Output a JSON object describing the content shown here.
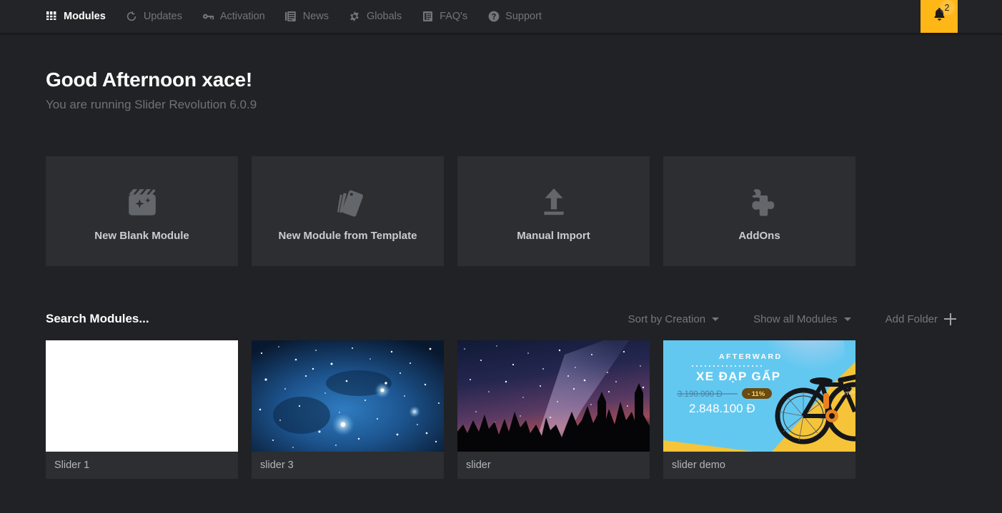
{
  "topbar": {
    "nav": [
      {
        "label": "Modules",
        "icon": "grid-icon",
        "active": true
      },
      {
        "label": "Updates",
        "icon": "refresh-icon",
        "active": false
      },
      {
        "label": "Activation",
        "icon": "key-icon",
        "active": false
      },
      {
        "label": "News",
        "icon": "newspaper-icon",
        "active": false
      },
      {
        "label": "Globals",
        "icon": "gear-icon",
        "active": false
      },
      {
        "label": "FAQ's",
        "icon": "book-icon",
        "active": false
      },
      {
        "label": "Support",
        "icon": "question-icon",
        "active": false
      }
    ],
    "notification": {
      "icon": "bell-icon",
      "count": "2",
      "background": "#ffb617"
    }
  },
  "greeting": {
    "title": "Good Afternoon xace!",
    "subtitle": "You are running Slider Revolution 6.0.9"
  },
  "action_cards": [
    {
      "label": "New Blank Module",
      "icon": "clapperboard-sparkle-icon"
    },
    {
      "label": "New Module from Template",
      "icon": "template-tag-icon"
    },
    {
      "label": "Manual Import",
      "icon": "upload-icon"
    },
    {
      "label": "AddOns",
      "icon": "puzzle-piece-icon"
    }
  ],
  "toolbar": {
    "search_placeholder": "Search Modules...",
    "search_value": "",
    "sort_label": "Sort by Creation",
    "filter_label": "Show all Modules",
    "add_folder_label": "Add Folder"
  },
  "modules": [
    {
      "name": "Slider 1",
      "thumb": "white-blank"
    },
    {
      "name": "slider 3",
      "thumb": "blue-starfield"
    },
    {
      "name": "slider",
      "thumb": "milky-way-pines"
    },
    {
      "name": "slider demo",
      "thumb": "bicycle-ad"
    }
  ],
  "bicycle_ad": {
    "brand": "AFTERWARD",
    "headline": "XE ĐẠP GẤP",
    "old_price": "3.190.000 Đ",
    "discount": "- 11%",
    "new_price": "2.848.100 Đ",
    "bike_label": "AFTERWARD",
    "colors": {
      "sky": "#63c8f0",
      "yellow": "#f5c438",
      "badge": "#6b4a13"
    }
  },
  "colors": {
    "page_background": "#212225",
    "topbar_background": "#232427",
    "card_background": "#2c2e31",
    "accent": "#ffb617",
    "muted_text": "#75787d"
  }
}
